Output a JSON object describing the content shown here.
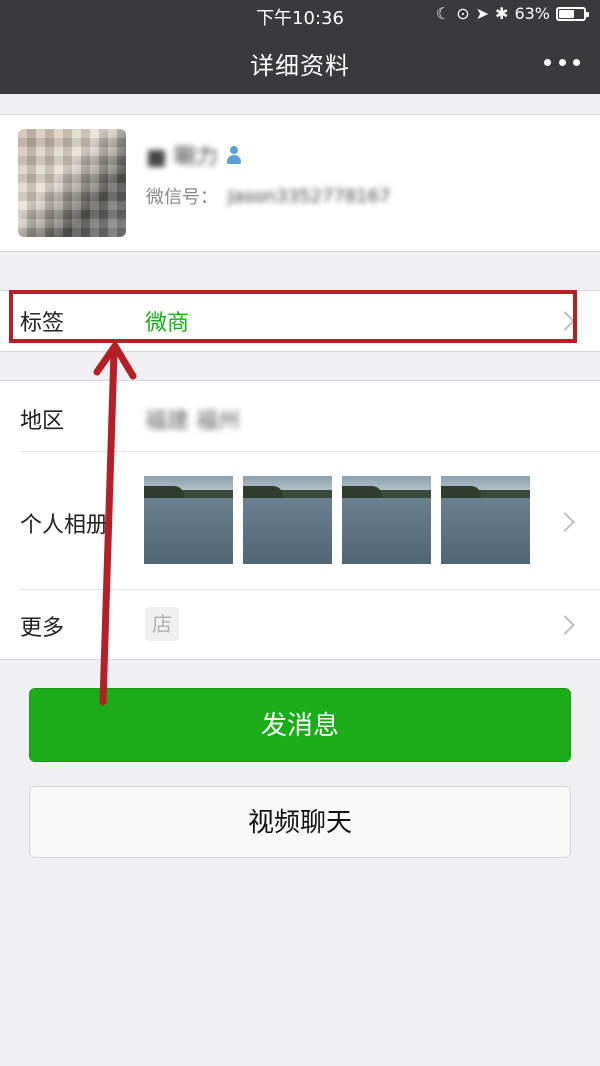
{
  "status_bar": {
    "time": "下午10:36",
    "battery": "63%",
    "battery_fraction": 0.63
  },
  "nav": {
    "title": "详细资料"
  },
  "profile": {
    "name": "■ 唰力",
    "wechat_label": "微信号：",
    "wechat_id": "Jason3352778167"
  },
  "tag_row": {
    "label": "标签",
    "value": "微商",
    "value_color": "#1aad19",
    "highlight_color": "#b51f25"
  },
  "info": {
    "region_label": "地区",
    "region_value": "福建 福州",
    "album_label": "个人相册",
    "photos_count": 4,
    "more_label": "更多",
    "shop_icon_text": "店"
  },
  "buttons": {
    "send_message": "发消息",
    "video_chat": "视频聊天"
  },
  "colors": {
    "accent_green": "#1aad19",
    "header": "#3a3a3e",
    "arrow": "#b51f25"
  }
}
